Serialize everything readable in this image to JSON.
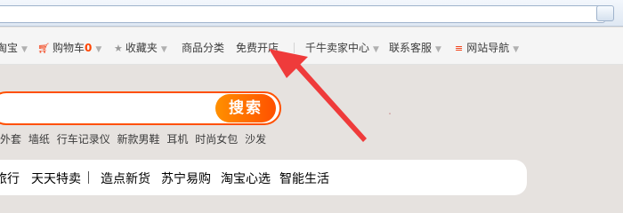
{
  "nav": {
    "taobao_partial": "淘宝",
    "cart_label": "购物车",
    "cart_count": "0",
    "favorites": "收藏夹",
    "categories": "商品分类",
    "free_store": "免费开店",
    "seller_center": "千牛卖家中心",
    "customer_service": "联系客服",
    "site_nav": "网站导航"
  },
  "search": {
    "button_label": "搜索",
    "hot_keywords": [
      "女外套",
      "墙纸",
      "行车记录仪",
      "新款男鞋",
      "耳机",
      "时尚女包",
      "沙发"
    ]
  },
  "channels": [
    "旅行",
    "天天特卖",
    "造点新货",
    "苏宁易购",
    "淘宝心选",
    "智能生活"
  ],
  "colors": {
    "brand_orange": "#ff5000",
    "arrow_red": "#ef3b3b",
    "nav_bg": "#f5f5f5"
  },
  "icons": {
    "cart": "cart-icon",
    "favorites": "star-icon",
    "site_nav": "menu-icon",
    "caret": "chevron-down-icon"
  }
}
